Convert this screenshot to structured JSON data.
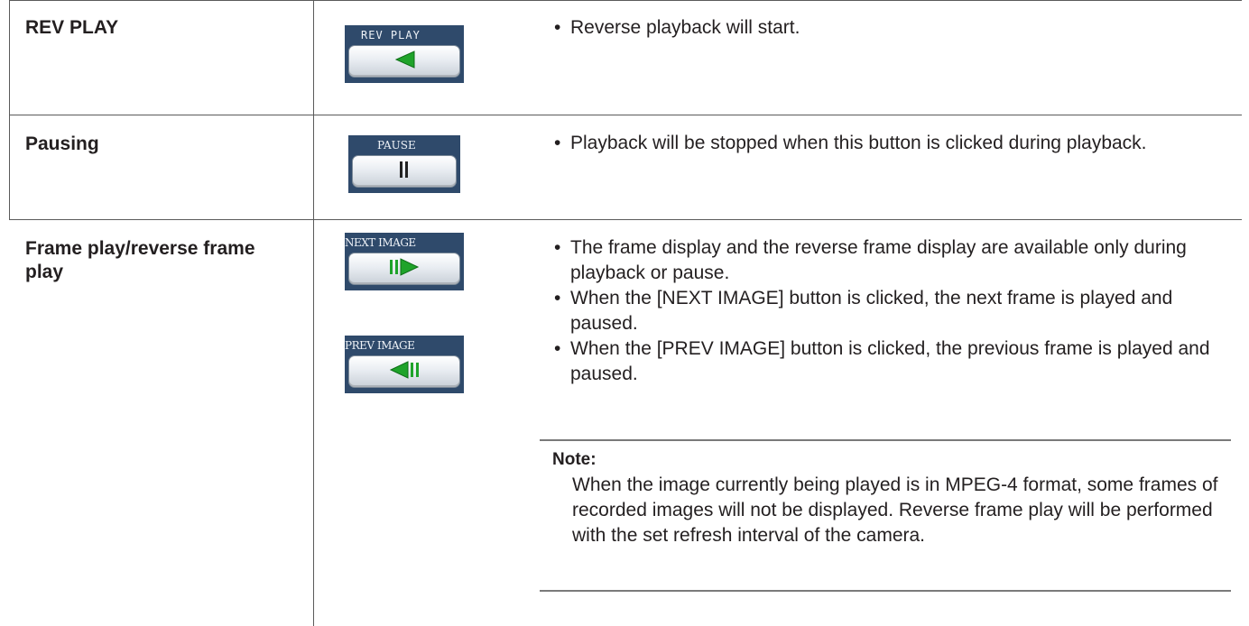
{
  "rows": [
    {
      "feature": "REV PLAY",
      "buttons": [
        {
          "caption": "REV PLAY",
          "icon": "reverse-play-icon"
        }
      ],
      "bullets": [
        "Reverse playback will start."
      ]
    },
    {
      "feature": "Pausing",
      "buttons": [
        {
          "caption": "PAUSE",
          "icon": "pause-icon"
        }
      ],
      "bullets": [
        "Playback will be stopped when this button is clicked during playback."
      ]
    },
    {
      "feature": "Frame play/reverse frame play",
      "buttons": [
        {
          "caption": "NEXT IMAGE",
          "icon": "next-frame-icon"
        },
        {
          "caption": "PREV IMAGE",
          "icon": "previous-frame-icon"
        }
      ],
      "bullets": [
        "The frame display and the reverse frame display are available only during playback or pause.",
        "When the [NEXT IMAGE] button is clicked, the next frame is played and paused.",
        "When the [PREV IMAGE] button is clicked, the previous frame is played and paused."
      ],
      "note": {
        "label": "Note:",
        "text": "When the image currently being played is in MPEG-4 format, some frames of recorded images will not be displayed. Reverse frame play will be performed with the set refresh interval of the camera."
      }
    }
  ],
  "bullet_char": "•",
  "colors": {
    "panel_bg": "#2f4a6b",
    "caption_text": "#eef2f7",
    "icon_green": "#1fa32a"
  }
}
